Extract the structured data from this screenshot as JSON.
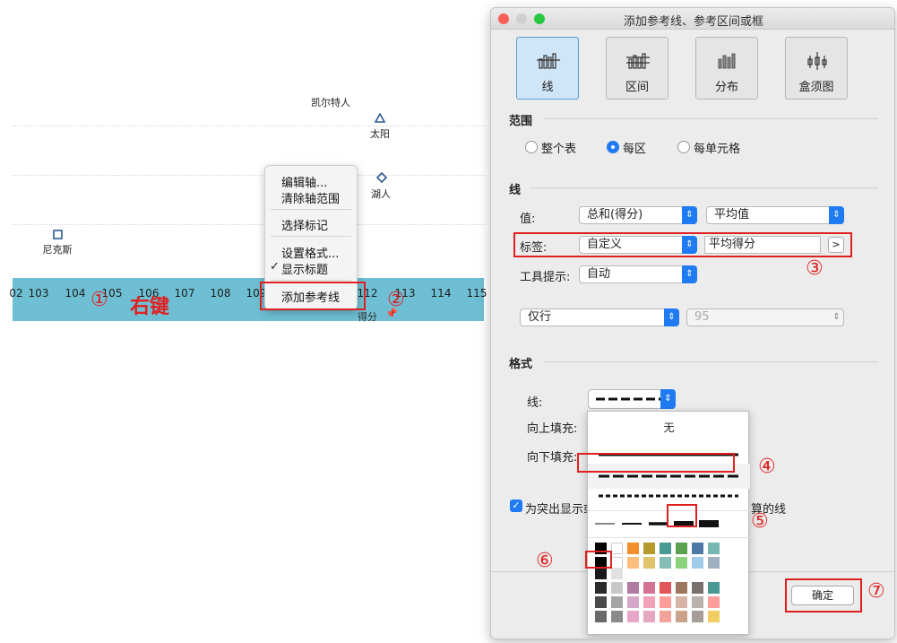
{
  "chart": {
    "ticks": [
      "02",
      "103",
      "104",
      "105",
      "106",
      "107",
      "108",
      "109",
      "110",
      "111",
      "112",
      "113",
      "114",
      "115"
    ],
    "axis_title": "得分",
    "points": [
      {
        "label": "凯尔特人",
        "marker": "none"
      },
      {
        "label": "太阳",
        "marker": "triangle"
      },
      {
        "label": "湖人",
        "marker": "diamond"
      },
      {
        "label": "尼克斯",
        "marker": "square"
      }
    ],
    "right_click_label": "右键"
  },
  "context_menu": {
    "items": [
      {
        "label": "编辑轴..."
      },
      {
        "label": "清除轴范围"
      },
      {
        "label": "选择标记"
      },
      {
        "label": "设置格式..."
      },
      {
        "label": "显示标题",
        "checked": true
      },
      {
        "label": "添加参考线"
      }
    ],
    "check_mark": "✓"
  },
  "annotations": [
    "①",
    "②",
    "③",
    "④",
    "⑤",
    "⑥",
    "⑦"
  ],
  "dialog": {
    "title": "添加参考线、参考区间或框",
    "types": [
      {
        "label": "线",
        "active": true
      },
      {
        "label": "区间",
        "active": false
      },
      {
        "label": "分布",
        "active": false
      },
      {
        "label": "盒须图",
        "active": false
      }
    ],
    "range": {
      "title": "范围",
      "options": [
        {
          "label": "整个表",
          "selected": false
        },
        {
          "label": "每区",
          "selected": true
        },
        {
          "label": "每单元格",
          "selected": false
        }
      ]
    },
    "line": {
      "title": "线",
      "value_label": "值:",
      "value_field": "总和(得分)",
      "value_agg": "平均值",
      "label_label": "标签:",
      "label_type": "自定义",
      "label_text": "平均得分",
      "label_button": ">",
      "tooltip_label": "工具提示:",
      "tooltip_value": "自动",
      "scope_value": "仅行",
      "percentile_value": "95"
    },
    "format": {
      "title": "格式",
      "line_label": "线:",
      "fill_above_label": "向上填充:",
      "fill_below_label": "向下填充:",
      "dropdown_none": "无"
    },
    "checkbox": {
      "label_start": "为突出显示或",
      "label_end": "算的线",
      "checked": true,
      "check_mark": "✓"
    },
    "confirm_label": "确定"
  },
  "colors": {
    "axis_band": "#6ebfd3",
    "accent": "#1f7bf2",
    "annotation": "#e02020",
    "swatch_columns": [
      [
        "#000000",
        "#000000",
        "#2b2b2b",
        "#4a4a4a",
        "#6a6a6a"
      ],
      [
        "#ffffff",
        "#ffffff",
        "#c8c8c8",
        "#a5a5a5",
        "#8a8a8a"
      ],
      [
        "#f28e2b",
        "#ffbe7d",
        "#b07aa1",
        "#d4a6c8",
        "#e8a5c8"
      ],
      [
        "#b6992d",
        "#e0c36b",
        "#d37295",
        "#f1a2b9",
        "#e6a8c0"
      ],
      [
        "#499894",
        "#86bcb6",
        "#e15759",
        "#ff9d9a",
        "#f3a39a"
      ],
      [
        "#59a14f",
        "#8cd17d",
        "#9d7660",
        "#d7b5a6",
        "#c9a38a"
      ],
      [
        "#4e79a7",
        "#a0cbe8",
        "#79706e",
        "#bab0ac",
        "#a69d98"
      ],
      [
        "#76b7b2",
        "#9fb1c1",
        "#499894",
        "#ff9d9a",
        "#f1ce63"
      ]
    ]
  }
}
